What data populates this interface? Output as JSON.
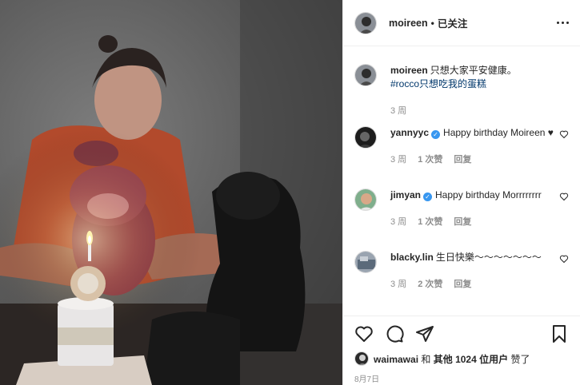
{
  "post": {
    "username": "moireen",
    "follow_separator": "•",
    "follow_status": "已关注"
  },
  "caption": {
    "username": "moireen",
    "text": "只想大家平安健康。",
    "hashtag": "#rocco只想吃我的蛋糕",
    "time": "3 周"
  },
  "comments": [
    {
      "username": "yannyyc",
      "verified": true,
      "text": "Happy birthday Moireen ♥",
      "time": "3 周",
      "likes": "1 次赞",
      "reply": "回复"
    },
    {
      "username": "jimyan",
      "verified": true,
      "text": "Happy birthday Morrrrrrrr",
      "time": "3 周",
      "likes": "1 次赞",
      "reply": "回复"
    },
    {
      "username": "blacky.lin",
      "verified": false,
      "text": "生日快樂～～～～～～～",
      "time": "3 周",
      "likes": "2 次赞",
      "reply": "回复"
    }
  ],
  "likes_line": {
    "first_user": "waimawai",
    "joiner": "和",
    "others": "其他 1024 位用户",
    "suffix": "赞了"
  },
  "date": "8月7日",
  "icons": {
    "header": "more-options-icon",
    "actions": [
      "heart-icon",
      "comment-icon",
      "share-icon",
      "bookmark-icon"
    ]
  },
  "colors": {
    "verified": "#3897f0",
    "hashtag": "#00376b",
    "muted": "#8e8e8e"
  }
}
